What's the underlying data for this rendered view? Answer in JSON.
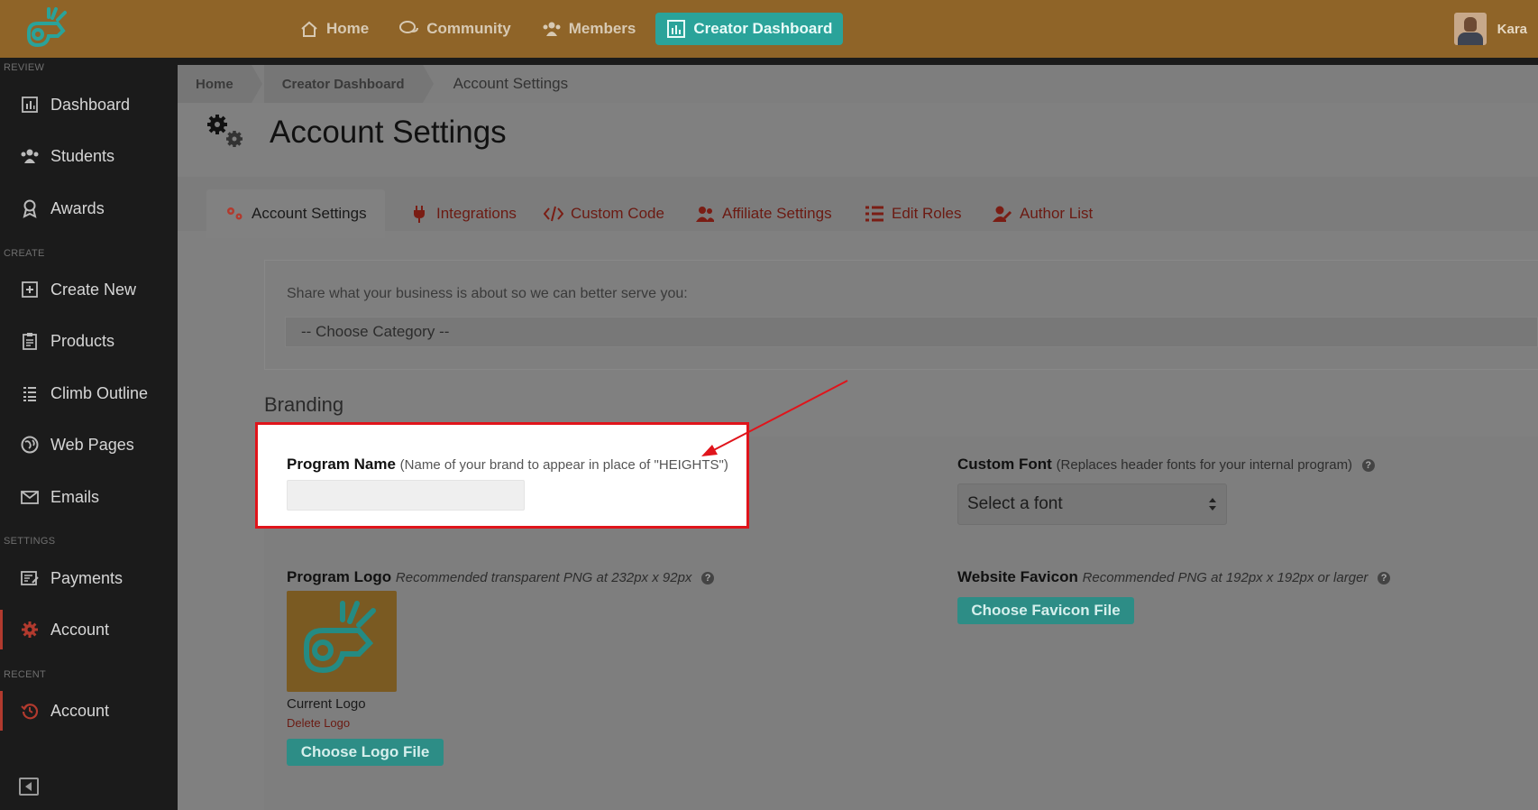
{
  "topnav": {
    "items": [
      {
        "label": "Home",
        "icon": "home-icon"
      },
      {
        "label": "Community",
        "icon": "chat-icon"
      },
      {
        "label": "Members",
        "icon": "members-icon"
      },
      {
        "label": "Creator Dashboard",
        "icon": "chart-icon",
        "active": true
      }
    ],
    "user_name": "Kara",
    "brand_color": "#8f6428",
    "accent_color": "#2aa39a"
  },
  "sidebar": {
    "sections": {
      "review": "REVIEW",
      "create": "CREATE",
      "settings": "SETTINGS",
      "recent": "RECENT"
    },
    "items": [
      {
        "label": "Dashboard",
        "icon": "bar-chart-icon"
      },
      {
        "label": "Students",
        "icon": "users-icon"
      },
      {
        "label": "Awards",
        "icon": "award-icon"
      },
      {
        "label": "Create New",
        "icon": "plus-square-icon"
      },
      {
        "label": "Products",
        "icon": "clipboard-icon"
      },
      {
        "label": "Climb Outline",
        "icon": "list-icon"
      },
      {
        "label": "Web Pages",
        "icon": "globe-icon"
      },
      {
        "label": "Emails",
        "icon": "email-icon"
      },
      {
        "label": "Payments",
        "icon": "payments-icon"
      },
      {
        "label": "Account",
        "icon": "gear-icon",
        "active": true
      },
      {
        "label": "Account",
        "icon": "history-icon",
        "active": true
      }
    ]
  },
  "breadcrumb": {
    "home": "Home",
    "creator": "Creator Dashboard",
    "current": "Account Settings"
  },
  "page": {
    "title": "Account Settings"
  },
  "tabs": [
    {
      "label": "Account Settings",
      "icon": "gears-icon",
      "active": true
    },
    {
      "label": "Integrations",
      "icon": "plug-icon"
    },
    {
      "label": "Custom Code",
      "icon": "code-icon"
    },
    {
      "label": "Affiliate Settings",
      "icon": "users-icon"
    },
    {
      "label": "Edit Roles",
      "icon": "list-icon"
    },
    {
      "label": "Author List",
      "icon": "user-edit-icon"
    }
  ],
  "category": {
    "label": "Share what your business is about so we can better serve you:",
    "selected": "-- Choose Category --"
  },
  "branding": {
    "heading": "Branding",
    "program_name": {
      "label": "Program Name",
      "hint": "(Name of your brand to appear in place of \"HEIGHTS\")",
      "value": ""
    },
    "custom_font": {
      "label": "Custom Font",
      "hint": "(Replaces header fonts for your internal program)",
      "selected": "Select a font"
    },
    "program_logo": {
      "label": "Program Logo",
      "hint": "Recommended transparent PNG at 232px x 92px",
      "current": "Current Logo",
      "delete": "Delete Logo",
      "button": "Choose Logo File"
    },
    "favicon": {
      "label": "Website Favicon",
      "hint": "Recommended PNG at 192px x 192px or larger",
      "button": "Choose Favicon File"
    },
    "help_glyph": "?"
  },
  "highlight_color": "#e0141b"
}
